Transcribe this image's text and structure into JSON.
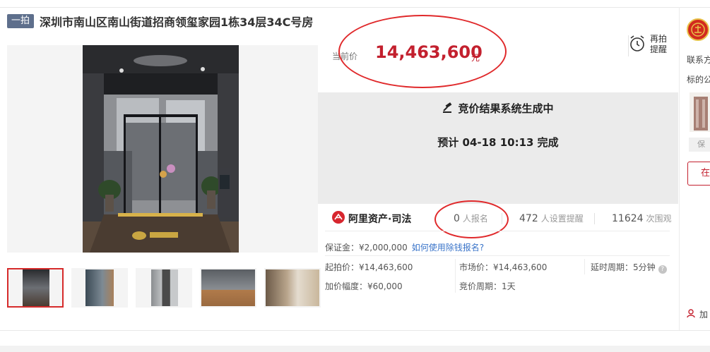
{
  "header": {
    "tag": "一拍",
    "title": "深圳市南山区南山街道招商领玺家园1栋34层34C号房"
  },
  "gallery": {
    "thumbnail_count": 5,
    "active_index": 0
  },
  "price": {
    "label": "当前价",
    "value": "14,463,600",
    "unit": "元"
  },
  "reminder": {
    "label": "再拍提醒",
    "icon": "alarm-clock-icon"
  },
  "status": {
    "line1": "竞价结果系统生成中",
    "line2": "预计 04-18 10:13 完成",
    "icon": "gavel-icon"
  },
  "brand": {
    "name": "阿里资产·司法"
  },
  "stats": [
    {
      "num": "0",
      "label": "人报名"
    },
    {
      "num": "472",
      "label": "人设置提醒"
    },
    {
      "num": "11624",
      "label": "次围观"
    }
  ],
  "deposit": {
    "text": "保证金：¥2,000,000",
    "link": "如何使用除钱报名?"
  },
  "details": {
    "start_price": "起拍价：¥14,463,600",
    "market_price": "市场价：¥14,463,600",
    "delay": "延时周期：5分钟",
    "increment": "加价幅度：¥60,000",
    "bid_period": "竞价周期：1天"
  },
  "sidebar": {
    "contact": "联系方",
    "subject": "标的公",
    "chip": "保",
    "button": "在",
    "bottom": "加"
  },
  "colors": {
    "accent_red": "#c3202e",
    "link_blue": "#3a74c9",
    "tag_bg": "#5e6f8c",
    "status_bg": "#ebebeb",
    "annotation_red": "#e0292b"
  }
}
